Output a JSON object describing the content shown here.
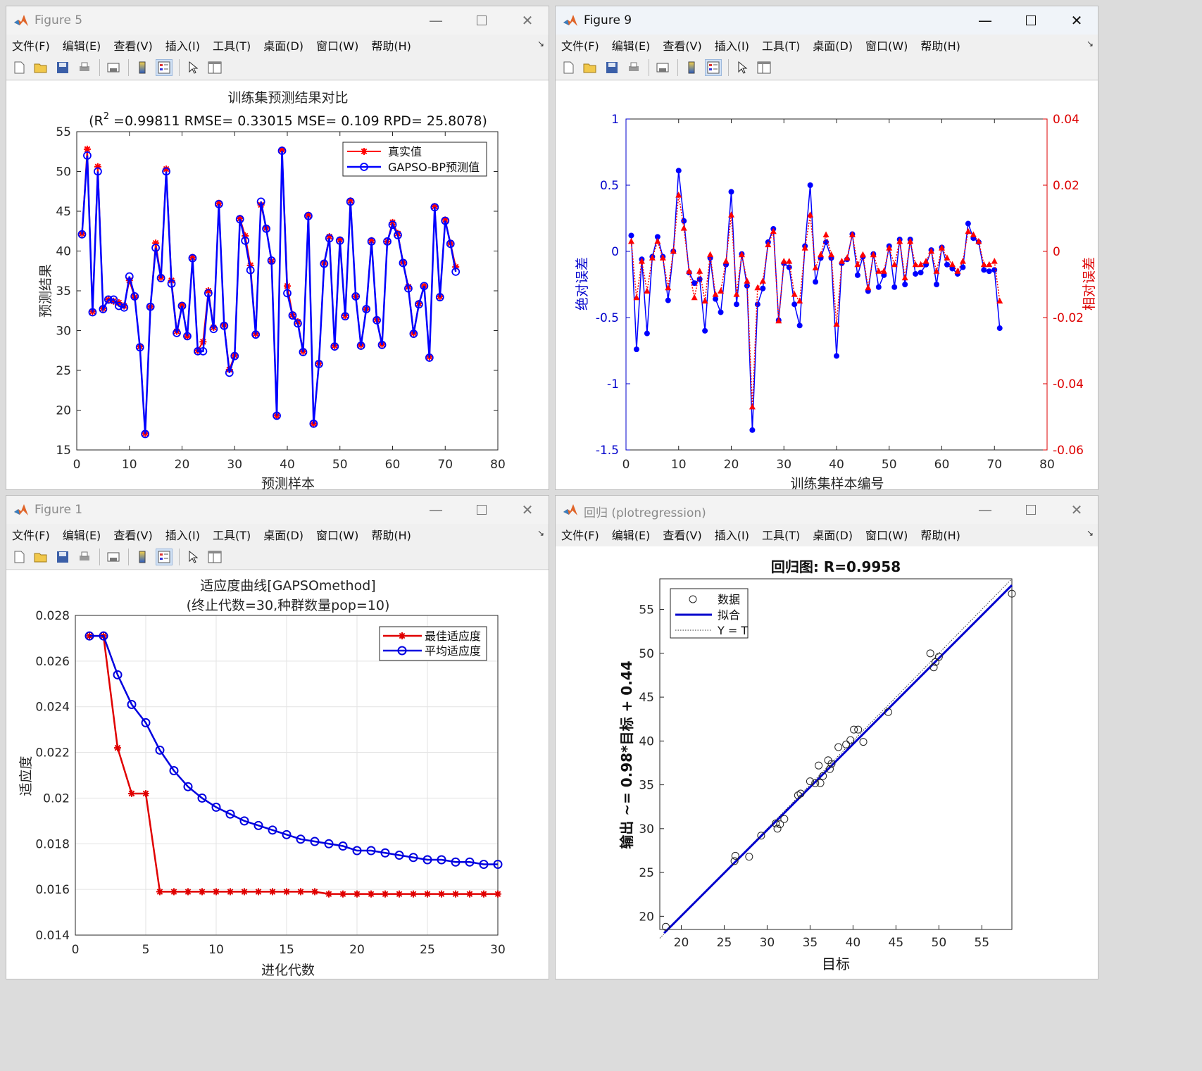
{
  "menu": [
    "文件(F)",
    "编辑(E)",
    "查看(V)",
    "插入(I)",
    "工具(T)",
    "桌面(D)",
    "窗口(W)",
    "帮助(H)"
  ],
  "toolbar_icons": [
    "new-file-icon",
    "open-folder-icon",
    "save-icon",
    "print-icon",
    "print-preview-icon",
    "colorbar-icon",
    "legend-icon",
    "pointer-icon",
    "property-inspector-icon"
  ],
  "windows": {
    "fig5": {
      "title": "Figure 5"
    },
    "fig9": {
      "title": "Figure 9"
    },
    "fig1": {
      "title": "Figure 1"
    },
    "reg": {
      "title": "回归 (plotregression)"
    }
  },
  "chart_data": [
    {
      "id": "fig5",
      "type": "line",
      "title_line1": "训练集预测结果对比",
      "title_line2_prefix": "(R",
      "title_line2_sup": "2",
      "title_line2_rest": " =0.99811 RMSE= 0.33015 MSE= 0.109 RPD= 25.8078)",
      "xlabel": "预测样本",
      "ylabel": "预测结果",
      "xlim": [
        0,
        80
      ],
      "ylim": [
        15,
        55
      ],
      "xticks": [
        0,
        10,
        20,
        30,
        40,
        50,
        60,
        70,
        80
      ],
      "yticks": [
        15,
        20,
        25,
        30,
        35,
        40,
        45,
        50,
        55
      ],
      "legend_position": "top-right",
      "series": [
        {
          "name": "真实值",
          "color": "#ff0000",
          "marker": "star",
          "values": [
            42.2,
            52.8,
            32.4,
            50.6,
            32.8,
            33.9,
            33.7,
            33.5,
            33.1,
            36.3,
            34.2,
            28.0,
            17.1,
            33.0,
            41.0,
            36.7,
            50.3,
            36.3,
            29.9,
            33.2,
            29.3,
            39.2,
            27.5,
            28.6,
            35.0,
            30.4,
            46.0,
            30.7,
            25.1,
            26.9,
            44.1,
            41.9,
            38.2,
            29.6,
            45.8,
            42.9,
            38.7,
            19.3,
            52.7,
            35.6,
            32.0,
            31.1,
            27.4,
            44.5,
            18.3,
            25.9,
            38.5,
            41.8,
            28.1,
            41.4,
            31.9,
            46.3,
            34.3,
            28.2,
            32.7,
            41.3,
            31.4,
            28.3,
            41.2,
            43.6,
            42.2,
            38.6,
            35.5,
            29.7,
            33.4,
            35.6,
            26.7,
            45.6,
            34.3,
            43.9,
            41.0,
            38.0
          ]
        },
        {
          "name": "GAPSO-BP预测值",
          "color": "#0000ff",
          "marker": "circle",
          "values": [
            42.1,
            52.0,
            32.3,
            50.0,
            32.7,
            33.9,
            33.9,
            33.1,
            32.9,
            36.8,
            34.3,
            27.9,
            17.0,
            33.0,
            40.4,
            36.6,
            50.0,
            35.9,
            29.7,
            33.1,
            29.3,
            39.1,
            27.4,
            27.4,
            34.7,
            30.2,
            45.9,
            30.6,
            24.7,
            26.8,
            44.0,
            41.3,
            37.6,
            29.5,
            46.2,
            42.8,
            38.8,
            19.3,
            52.6,
            34.7,
            31.9,
            30.9,
            27.3,
            44.4,
            18.3,
            25.8,
            38.4,
            41.6,
            28.0,
            41.3,
            31.8,
            46.2,
            34.3,
            28.1,
            32.7,
            41.2,
            31.3,
            28.2,
            41.2,
            43.3,
            42.0,
            38.5,
            35.3,
            29.6,
            33.3,
            35.6,
            26.6,
            45.5,
            34.2,
            43.8,
            40.9,
            37.4
          ]
        }
      ]
    },
    {
      "id": "fig9",
      "type": "line",
      "xlabel": "训练集样本编号",
      "ylabel_left": "绝对误差",
      "ylabel_right": "相对误差",
      "xlim": [
        0,
        80
      ],
      "ylim_left": [
        -1.5,
        1
      ],
      "ylim_right": [
        -0.06,
        0.04
      ],
      "xticks": [
        0,
        10,
        20,
        30,
        40,
        50,
        60,
        70,
        80
      ],
      "yticks_left": [
        -1.5,
        -1,
        -0.5,
        0,
        0.5,
        1
      ],
      "yticks_right": [
        -0.06,
        -0.04,
        -0.02,
        0,
        0.02,
        0.04
      ],
      "series": [
        {
          "axis": "left",
          "color": "#0000ff",
          "marker": "dot",
          "values": [
            0.12,
            -0.74,
            -0.06,
            -0.62,
            -0.04,
            0.11,
            -0.04,
            -0.37,
            0.0,
            0.61,
            0.23,
            -0.16,
            -0.24,
            -0.21,
            -0.6,
            -0.05,
            -0.36,
            -0.46,
            -0.1,
            0.45,
            -0.4,
            -0.02,
            -0.26,
            -1.35,
            -0.4,
            -0.28,
            0.07,
            0.17,
            -0.52,
            -0.09,
            -0.12,
            -0.4,
            -0.56,
            0.04,
            0.5,
            -0.23,
            -0.05,
            0.07,
            -0.05,
            -0.79,
            -0.09,
            -0.06,
            0.13,
            -0.18,
            -0.04,
            -0.3,
            -0.02,
            -0.27,
            -0.18,
            0.04,
            -0.27,
            0.09,
            -0.25,
            0.09,
            -0.17,
            -0.16,
            -0.1,
            0.01,
            -0.25,
            0.03,
            -0.1,
            -0.13,
            -0.17,
            -0.12,
            0.21,
            0.1,
            0.07,
            -0.14,
            -0.15,
            -0.14,
            -0.58
          ]
        },
        {
          "axis": "right",
          "color": "#ff0000",
          "marker": "triangle",
          "values": [
            0.003,
            -0.014,
            -0.003,
            -0.012,
            -0.002,
            0.003,
            -0.002,
            -0.011,
            0.0,
            0.017,
            0.007,
            -0.006,
            -0.014,
            -0.006,
            -0.015,
            -0.001,
            -0.013,
            -0.012,
            -0.003,
            0.011,
            -0.013,
            -0.001,
            -0.009,
            -0.047,
            -0.011,
            -0.009,
            0.002,
            0.006,
            -0.021,
            -0.003,
            -0.003,
            -0.013,
            -0.015,
            0.001,
            0.011,
            -0.005,
            -0.001,
            0.005,
            -0.001,
            -0.022,
            -0.003,
            -0.002,
            0.005,
            -0.004,
            -0.001,
            -0.011,
            -0.001,
            -0.006,
            -0.006,
            0.001,
            -0.004,
            0.003,
            -0.008,
            0.003,
            -0.004,
            -0.004,
            -0.003,
            0.0,
            -0.006,
            0.001,
            -0.002,
            -0.004,
            -0.006,
            -0.003,
            0.006,
            0.005,
            0.003,
            -0.004,
            -0.004,
            -0.003,
            -0.015
          ]
        }
      ]
    },
    {
      "id": "fig1",
      "type": "line",
      "title_line1": "适应度曲线[GAPSOmethod]",
      "title_line2": "(终止代数=30,种群数量pop=10)",
      "xlabel": "进化代数",
      "ylabel": "适应度",
      "xlim": [
        0,
        30
      ],
      "ylim": [
        0.014,
        0.028
      ],
      "xticks": [
        0,
        5,
        10,
        15,
        20,
        25,
        30
      ],
      "yticks": [
        0.014,
        0.016,
        0.018,
        0.02,
        0.022,
        0.024,
        0.026,
        0.028
      ],
      "ytick_labels": [
        "0.014",
        "0.016",
        "0.018",
        "0.02",
        "0.022",
        "0.024",
        "0.026",
        "0.028"
      ],
      "grid": true,
      "legend_position": "top-right",
      "x": [
        1,
        2,
        3,
        4,
        5,
        6,
        7,
        8,
        9,
        10,
        11,
        12,
        13,
        14,
        15,
        16,
        17,
        18,
        19,
        20,
        21,
        22,
        23,
        24,
        25,
        26,
        27,
        28,
        29,
        30
      ],
      "series": [
        {
          "name": "最佳适应度",
          "color": "#e00000",
          "marker": "star",
          "values": [
            0.0271,
            0.0271,
            0.0222,
            0.0202,
            0.0202,
            0.0159,
            0.0159,
            0.0159,
            0.0159,
            0.0159,
            0.0159,
            0.0159,
            0.0159,
            0.0159,
            0.0159,
            0.0159,
            0.0159,
            0.0158,
            0.0158,
            0.0158,
            0.0158,
            0.0158,
            0.0158,
            0.0158,
            0.0158,
            0.0158,
            0.0158,
            0.0158,
            0.0158,
            0.0158
          ]
        },
        {
          "name": "平均适应度",
          "color": "#0000e0",
          "marker": "circle",
          "values": [
            0.0271,
            0.0271,
            0.0254,
            0.0241,
            0.0233,
            0.0221,
            0.0212,
            0.0205,
            0.02,
            0.0196,
            0.0193,
            0.019,
            0.0188,
            0.0186,
            0.0184,
            0.0182,
            0.0181,
            0.018,
            0.0179,
            0.0177,
            0.0177,
            0.0176,
            0.0175,
            0.0174,
            0.0173,
            0.0173,
            0.0172,
            0.0172,
            0.0171,
            0.0171
          ]
        }
      ]
    },
    {
      "id": "reg",
      "type": "scatter",
      "title": "回归图: R=0.9958",
      "xlabel": "目标",
      "ylabel": "输出 ~= 0.98*目标 + 0.44",
      "xlim": [
        17.5,
        58.5
      ],
      "ylim": [
        18.5,
        58.5
      ],
      "xticks": [
        20,
        25,
        30,
        35,
        40,
        45,
        50,
        55
      ],
      "yticks": [
        20,
        25,
        30,
        35,
        40,
        45,
        50,
        55
      ],
      "legend_position": "top-left",
      "legend": [
        "数据",
        "拟合",
        "Y = T"
      ],
      "fit": {
        "slope": 0.98,
        "intercept": 0.44
      },
      "points": [
        [
          18.2,
          18.8
        ],
        [
          26.2,
          26.3
        ],
        [
          26.3,
          26.9
        ],
        [
          27.9,
          26.8
        ],
        [
          29.3,
          29.2
        ],
        [
          31,
          30.6
        ],
        [
          31.2,
          30
        ],
        [
          31.5,
          30.5
        ],
        [
          32,
          31.1
        ],
        [
          33.6,
          33.8
        ],
        [
          33.9,
          34
        ],
        [
          35,
          35.4
        ],
        [
          35.6,
          35.2
        ],
        [
          36,
          37.2
        ],
        [
          36.2,
          35.2
        ],
        [
          36.5,
          36
        ],
        [
          37.1,
          37.8
        ],
        [
          37.3,
          36.8
        ],
        [
          37.5,
          37.4
        ],
        [
          38.3,
          39.3
        ],
        [
          39.2,
          39.6
        ],
        [
          39.7,
          40.1
        ],
        [
          40.1,
          41.3
        ],
        [
          40.6,
          41.3
        ],
        [
          41.2,
          39.9
        ],
        [
          44.1,
          43.3
        ],
        [
          49,
          50
        ],
        [
          49.4,
          48.4
        ],
        [
          49.6,
          49
        ],
        [
          50,
          49.6
        ],
        [
          58.5,
          56.8
        ]
      ]
    }
  ]
}
